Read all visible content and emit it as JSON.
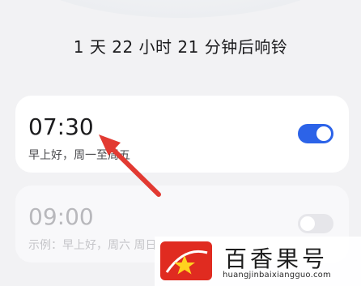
{
  "countdown": "1 天 22 小时 21 分钟后响铃",
  "alarms": [
    {
      "time": "07:30",
      "description": "早上好，周一至周五",
      "enabled": true
    },
    {
      "time": "09:00",
      "description": "示例：早上好，周六 周日",
      "enabled": false
    }
  ],
  "colors": {
    "accent": "#2c63e8",
    "arrow": "#e23a32",
    "watermark_red": "#e02b20"
  },
  "watermark": {
    "title": "百香果号",
    "url": "huangjinbaixiangguo.com"
  }
}
